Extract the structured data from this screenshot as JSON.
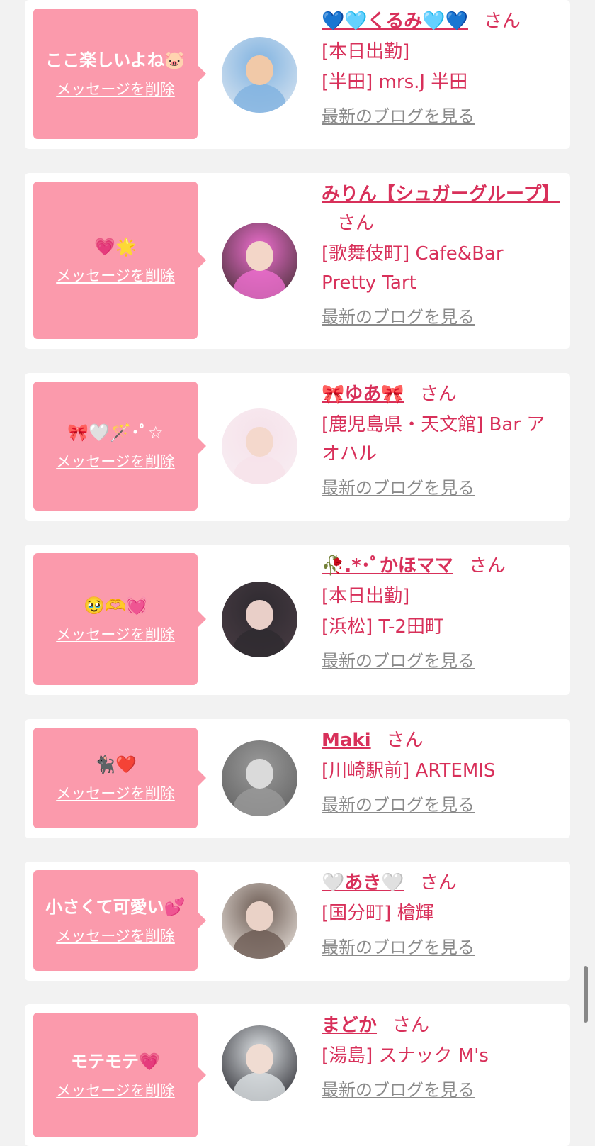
{
  "colors": {
    "page_bg": "#f2f2f2",
    "card_bg": "#ffffff",
    "bubble_bg": "#fb9aac",
    "accent": "#d8305a",
    "blog_link": "#8a8a8a"
  },
  "delete_label": "メッセージを削除",
  "blog_label": "最新のブログを見る",
  "honorific": "さん",
  "messages": [
    {
      "message": "ここ楽しいよね🐷",
      "name": "💙🩵くるみ🩵💙",
      "honorific": "さん",
      "lines": [
        "[本日出勤]",
        "[半田] mrs.J 半田"
      ],
      "avatar_colors": [
        "#7fb2e0",
        "#f1c9a8",
        "#dfe8f2"
      ]
    },
    {
      "message": "💗🌟",
      "name": "みりん【シュガーグループ】",
      "honorific": "さん",
      "lines": [
        "[歌舞伎町] Cafe&Bar Pretty Tart"
      ],
      "avatar_colors": [
        "#ef6fd0",
        "#f3d6c8",
        "#3a2a2a"
      ]
    },
    {
      "message": "🎀🤍🪄･ﾟ☆",
      "name": "🎀ゆあ🎀",
      "honorific": "さん",
      "lines": [
        "[鹿児島県・天文館] Bar アオハル"
      ],
      "avatar_colors": [
        "#f6e2ea",
        "#f4d8cc",
        "#f8eef3"
      ]
    },
    {
      "message": "🥹🫶💓",
      "name": "🥀.*･ﾟかほママ",
      "honorific": "さん",
      "lines": [
        "[本日出勤]",
        "[浜松] T-2田町"
      ],
      "avatar_colors": [
        "#2e2a30",
        "#e9cfc8",
        "#4a3d44"
      ]
    },
    {
      "message": "🐈‍⬛❤️",
      "name": "Maki",
      "honorific": "さん",
      "lines": [
        "[川崎駅前] ARTEMIS"
      ],
      "avatar_colors": [
        "#9a9a9a",
        "#dadada",
        "#5e5e5e"
      ]
    },
    {
      "message": "小さくて可愛い💕",
      "name": "🤍あき🤍",
      "honorific": "さん",
      "lines": [
        "[国分町] 檜輝"
      ],
      "avatar_colors": [
        "#6b5a52",
        "#ead2c7",
        "#f2ece6"
      ]
    },
    {
      "message": "モテモテ💗",
      "name": "まどか",
      "honorific": "さん",
      "lines": [
        "[湯島] スナック M's"
      ],
      "avatar_colors": [
        "#dfe3e6",
        "#f0dcd2",
        "#1e1e24"
      ]
    }
  ]
}
